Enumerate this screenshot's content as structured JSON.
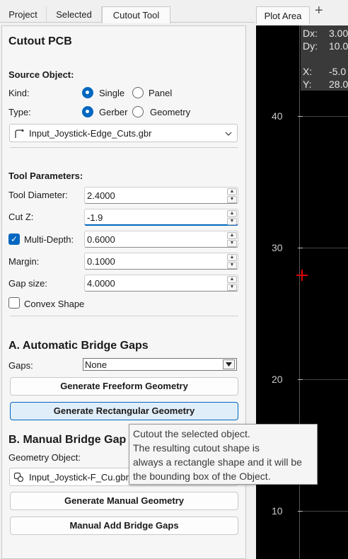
{
  "tabs": [
    "Project",
    "Selected",
    "Cutout Tool"
  ],
  "plot_tab": "Plot Area",
  "title": "Cutout PCB",
  "source": {
    "heading": "Source Object:",
    "kind_label": "Kind:",
    "kind_options": [
      "Single",
      "Panel"
    ],
    "type_label": "Type:",
    "type_options": [
      "Gerber",
      "Geometry"
    ],
    "object": "Input_Joystick-Edge_Cuts.gbr"
  },
  "tool": {
    "heading": "Tool Parameters:",
    "diameter_label": "Tool Diameter:",
    "diameter": "2.4000",
    "cutz_label": "Cut Z:",
    "cutz": "-1.9",
    "multidepth_label": "Multi-Depth:",
    "multidepth": "0.6000",
    "margin_label": "Margin:",
    "margin": "0.1000",
    "gapsize_label": "Gap size:",
    "gapsize": "4.0000",
    "convex_label": "Convex Shape"
  },
  "auto": {
    "heading": "A. Automatic Bridge Gaps",
    "gaps_label": "Gaps:",
    "gaps": "None",
    "freeform_btn": "Generate Freeform Geometry",
    "rect_btn": "Generate Rectangular Geometry"
  },
  "manual": {
    "heading": "B. Manual Bridge Gap",
    "geom_label": "Geometry Object:",
    "geom": "Input_Joystick-F_Cu.gbr_",
    "gen_btn": "Generate Manual Geometry",
    "add_btn": "Manual Add Bridge Gaps"
  },
  "coords": {
    "dx_label": "Dx:",
    "dx": "3.00",
    "dy_label": "Dy:",
    "dy": "10.0",
    "x_label": "X:",
    "x": "-5.0",
    "y_label": "Y:",
    "y": "28.0"
  },
  "y_ticks": [
    "40",
    "30",
    "20",
    "10"
  ],
  "tooltip": [
    "Cutout the selected object.",
    "The resulting cutout shape is",
    "always a rectangle shape and it will be",
    "the bounding box of the Object."
  ],
  "colors": {
    "accent": "#0067c0",
    "cursor": "#e00000"
  }
}
